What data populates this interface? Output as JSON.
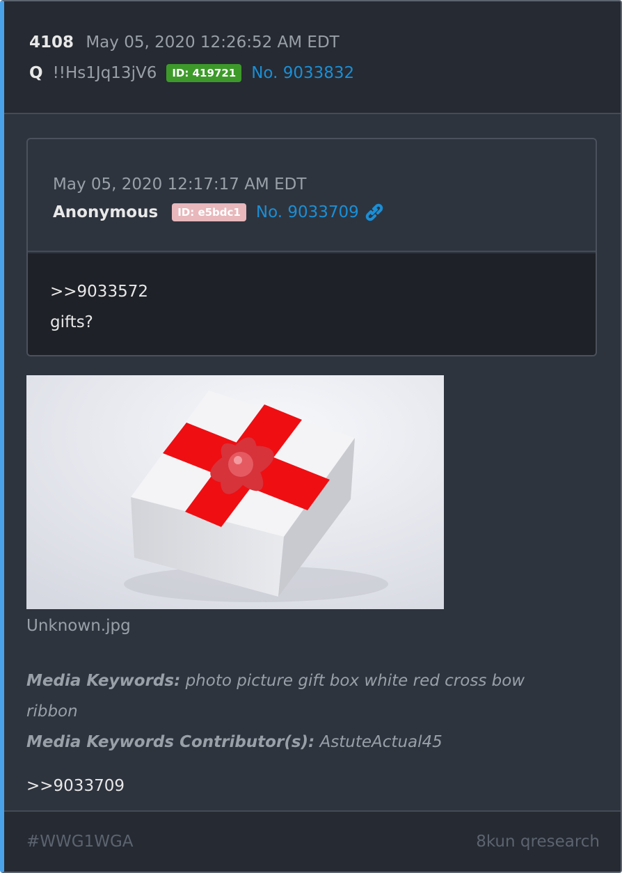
{
  "post": {
    "number": "4108",
    "datetime": "May 05, 2020 12:26:52 AM EDT",
    "author": "Q",
    "tripcode": "!!Hs1Jq13jV6",
    "id_badge": "ID: 419721",
    "id_color": "#3d9a2a",
    "post_link": "No. 9033832"
  },
  "quoted": {
    "datetime": "May 05, 2020 12:17:17 AM EDT",
    "author": "Anonymous",
    "id_badge": "ID: e5bdc1",
    "id_color": "#e8b8bc",
    "post_link": "No. 9033709",
    "link_icon": "link-icon",
    "body_lines": [
      ">>9033572",
      "gifts?"
    ]
  },
  "media": {
    "image": "gift-box-photo",
    "filename": "Unknown.jpg",
    "keywords_label": "Media Keywords:",
    "keywords": "photo picture gift box white red cross bow ribbon",
    "contributor_label": "Media Keywords Contributor(s):",
    "contributor": "AstuteActual45"
  },
  "reply": ">>9033709",
  "footer": {
    "hashtag": "#WWG1WGA",
    "source": "8kun qresearch"
  },
  "colors": {
    "accent_border": "#4aa3e8",
    "link": "#1a8fd6",
    "card_bg": "#2e343e"
  }
}
